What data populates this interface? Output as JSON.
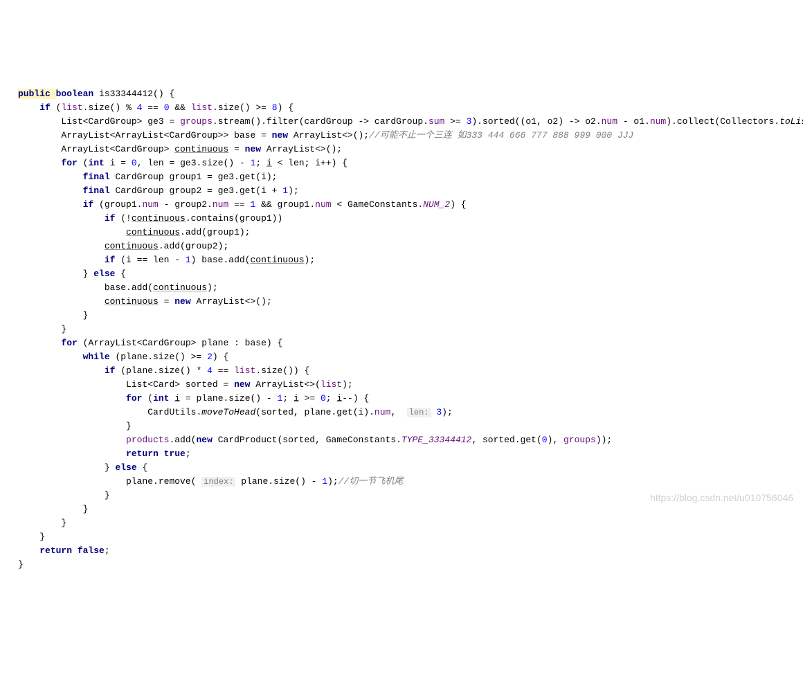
{
  "watermark": "https://blog.csdn.net/u010756046",
  "lines": [
    {
      "indent": 0,
      "tokens": [
        {
          "t": "public ",
          "c": "kw hl"
        },
        {
          "t": "boolean ",
          "c": "kw"
        },
        {
          "t": "is33344412() {",
          "c": ""
        }
      ]
    },
    {
      "indent": 1,
      "tokens": [
        {
          "t": "if ",
          "c": "kw"
        },
        {
          "t": "(",
          "c": ""
        },
        {
          "t": "list",
          "c": "fld"
        },
        {
          "t": ".size() % ",
          "c": ""
        },
        {
          "t": "4",
          "c": "num"
        },
        {
          "t": " == ",
          "c": ""
        },
        {
          "t": "0",
          "c": "num"
        },
        {
          "t": " && ",
          "c": ""
        },
        {
          "t": "list",
          "c": "fld"
        },
        {
          "t": ".size() >= ",
          "c": ""
        },
        {
          "t": "8",
          "c": "num"
        },
        {
          "t": ") {",
          "c": ""
        }
      ]
    },
    {
      "indent": 2,
      "tokens": [
        {
          "t": "List<CardGroup> ge3 = ",
          "c": ""
        },
        {
          "t": "groups",
          "c": "fld"
        },
        {
          "t": ".stream().filter(cardGroup -> cardGroup.",
          "c": ""
        },
        {
          "t": "sum",
          "c": "fld"
        },
        {
          "t": " >= ",
          "c": ""
        },
        {
          "t": "3",
          "c": "num"
        },
        {
          "t": ").sorted((o1, o2) -> o2.",
          "c": ""
        },
        {
          "t": "num",
          "c": "fld"
        },
        {
          "t": " - o1.",
          "c": ""
        },
        {
          "t": "num",
          "c": "fld"
        },
        {
          "t": ").collect(Collectors.",
          "c": ""
        },
        {
          "t": "toList",
          "c": "method-static"
        },
        {
          "t": "());",
          "c": ""
        }
      ]
    },
    {
      "indent": 0,
      "tokens": [
        {
          "t": "",
          "c": ""
        }
      ]
    },
    {
      "indent": 2,
      "tokens": [
        {
          "t": "ArrayList<ArrayList<CardGroup>> base = ",
          "c": ""
        },
        {
          "t": "new ",
          "c": "kw"
        },
        {
          "t": "ArrayList<>();",
          "c": ""
        },
        {
          "t": "//可能不止一个三连 如333 444 666 777 888 999 000 JJJ",
          "c": "cmt"
        }
      ]
    },
    {
      "indent": 2,
      "tokens": [
        {
          "t": "ArrayList<CardGroup> ",
          "c": ""
        },
        {
          "t": "continuous",
          "c": "underline"
        },
        {
          "t": " = ",
          "c": ""
        },
        {
          "t": "new ",
          "c": "kw"
        },
        {
          "t": "ArrayList<>();",
          "c": ""
        }
      ]
    },
    {
      "indent": 2,
      "tokens": [
        {
          "t": "for ",
          "c": "kw"
        },
        {
          "t": "(",
          "c": ""
        },
        {
          "t": "int ",
          "c": "kw"
        },
        {
          "t": "i = ",
          "c": ""
        },
        {
          "t": "0",
          "c": "num"
        },
        {
          "t": ", len = ge3.size() - ",
          "c": ""
        },
        {
          "t": "1",
          "c": "num"
        },
        {
          "t": "; ",
          "c": ""
        },
        {
          "t": "i",
          "c": "underline"
        },
        {
          "t": " < len; i++) {",
          "c": ""
        }
      ]
    },
    {
      "indent": 3,
      "tokens": [
        {
          "t": "final ",
          "c": "kw"
        },
        {
          "t": "CardGroup group1 = ge3.get(i);",
          "c": ""
        }
      ]
    },
    {
      "indent": 3,
      "tokens": [
        {
          "t": "final ",
          "c": "kw"
        },
        {
          "t": "CardGroup group2 = ge3.get(i + ",
          "c": ""
        },
        {
          "t": "1",
          "c": "num"
        },
        {
          "t": ");",
          "c": ""
        }
      ]
    },
    {
      "indent": 3,
      "tokens": [
        {
          "t": "if ",
          "c": "kw"
        },
        {
          "t": "(group1.",
          "c": ""
        },
        {
          "t": "num",
          "c": "fld"
        },
        {
          "t": " - group2.",
          "c": ""
        },
        {
          "t": "num",
          "c": "fld"
        },
        {
          "t": " == ",
          "c": ""
        },
        {
          "t": "1",
          "c": "num"
        },
        {
          "t": " && group1.",
          "c": ""
        },
        {
          "t": "num",
          "c": "fld"
        },
        {
          "t": " < GameConstants.",
          "c": ""
        },
        {
          "t": "NUM_2",
          "c": "fld-static"
        },
        {
          "t": ") {",
          "c": ""
        }
      ]
    },
    {
      "indent": 4,
      "tokens": [
        {
          "t": "if ",
          "c": "kw"
        },
        {
          "t": "(!",
          "c": ""
        },
        {
          "t": "continuous",
          "c": "underline"
        },
        {
          "t": ".contains(group1))",
          "c": ""
        }
      ]
    },
    {
      "indent": 5,
      "tokens": [
        {
          "t": "continuous",
          "c": "underline"
        },
        {
          "t": ".add(group1);",
          "c": ""
        }
      ]
    },
    {
      "indent": 4,
      "tokens": [
        {
          "t": "continuous",
          "c": "underline"
        },
        {
          "t": ".add(group2);",
          "c": ""
        }
      ]
    },
    {
      "indent": 4,
      "tokens": [
        {
          "t": "if ",
          "c": "kw"
        },
        {
          "t": "(i == len - ",
          "c": ""
        },
        {
          "t": "1",
          "c": "num"
        },
        {
          "t": ") base.add(",
          "c": ""
        },
        {
          "t": "continuous",
          "c": "underline"
        },
        {
          "t": ");",
          "c": ""
        }
      ]
    },
    {
      "indent": 3,
      "tokens": [
        {
          "t": "} ",
          "c": ""
        },
        {
          "t": "else ",
          "c": "kw"
        },
        {
          "t": "{",
          "c": ""
        }
      ]
    },
    {
      "indent": 4,
      "tokens": [
        {
          "t": "base.add(",
          "c": ""
        },
        {
          "t": "continuous",
          "c": "underline"
        },
        {
          "t": ");",
          "c": ""
        }
      ]
    },
    {
      "indent": 4,
      "tokens": [
        {
          "t": "continuous",
          "c": "underline"
        },
        {
          "t": " = ",
          "c": ""
        },
        {
          "t": "new ",
          "c": "kw"
        },
        {
          "t": "ArrayList<>();",
          "c": ""
        }
      ]
    },
    {
      "indent": 3,
      "tokens": [
        {
          "t": "}",
          "c": ""
        }
      ]
    },
    {
      "indent": 2,
      "tokens": [
        {
          "t": "}",
          "c": ""
        }
      ]
    },
    {
      "indent": 2,
      "tokens": [
        {
          "t": "for ",
          "c": "kw"
        },
        {
          "t": "(ArrayList<CardGroup> plane : base) {",
          "c": ""
        }
      ]
    },
    {
      "indent": 3,
      "tokens": [
        {
          "t": "while ",
          "c": "kw"
        },
        {
          "t": "(plane.size() >= ",
          "c": ""
        },
        {
          "t": "2",
          "c": "num"
        },
        {
          "t": ") {",
          "c": ""
        }
      ]
    },
    {
      "indent": 4,
      "tokens": [
        {
          "t": "if ",
          "c": "kw"
        },
        {
          "t": "(plane.size() * ",
          "c": ""
        },
        {
          "t": "4",
          "c": "num"
        },
        {
          "t": " == ",
          "c": ""
        },
        {
          "t": "list",
          "c": "fld"
        },
        {
          "t": ".size()) {",
          "c": ""
        }
      ]
    },
    {
      "indent": 5,
      "tokens": [
        {
          "t": "List<Card> sorted = ",
          "c": ""
        },
        {
          "t": "new ",
          "c": "kw"
        },
        {
          "t": "ArrayList<>(",
          "c": ""
        },
        {
          "t": "list",
          "c": "fld"
        },
        {
          "t": ");",
          "c": ""
        }
      ]
    },
    {
      "indent": 5,
      "tokens": [
        {
          "t": "for ",
          "c": "kw"
        },
        {
          "t": "(",
          "c": ""
        },
        {
          "t": "int ",
          "c": "kw"
        },
        {
          "t": "i",
          "c": "underline"
        },
        {
          "t": " = plane.size() - ",
          "c": ""
        },
        {
          "t": "1",
          "c": "num"
        },
        {
          "t": "; ",
          "c": ""
        },
        {
          "t": "i",
          "c": "underline"
        },
        {
          "t": " >= ",
          "c": ""
        },
        {
          "t": "0",
          "c": "num"
        },
        {
          "t": "; ",
          "c": ""
        },
        {
          "t": "i",
          "c": "underline"
        },
        {
          "t": "--) {",
          "c": ""
        }
      ]
    },
    {
      "indent": 6,
      "tokens": [
        {
          "t": "CardUtils.",
          "c": ""
        },
        {
          "t": "moveToHead",
          "c": "method-static"
        },
        {
          "t": "(sorted, plane.get(i).",
          "c": ""
        },
        {
          "t": "num",
          "c": "fld"
        },
        {
          "t": ",  ",
          "c": ""
        },
        {
          "t": "len:",
          "c": "param-hint"
        },
        {
          "t": " ",
          "c": ""
        },
        {
          "t": "3",
          "c": "num"
        },
        {
          "t": ");",
          "c": ""
        }
      ]
    },
    {
      "indent": 5,
      "tokens": [
        {
          "t": "}",
          "c": ""
        }
      ]
    },
    {
      "indent": 5,
      "tokens": [
        {
          "t": "products",
          "c": "fld"
        },
        {
          "t": ".add(",
          "c": ""
        },
        {
          "t": "new ",
          "c": "kw"
        },
        {
          "t": "CardProduct(sorted, GameConstants.",
          "c": ""
        },
        {
          "t": "TYPE_33344412",
          "c": "fld-static"
        },
        {
          "t": ", sorted.get(",
          "c": ""
        },
        {
          "t": "0",
          "c": "num"
        },
        {
          "t": "), ",
          "c": ""
        },
        {
          "t": "groups",
          "c": "fld"
        },
        {
          "t": "));",
          "c": ""
        }
      ]
    },
    {
      "indent": 5,
      "tokens": [
        {
          "t": "return true",
          "c": "kw"
        },
        {
          "t": ";",
          "c": ""
        }
      ]
    },
    {
      "indent": 4,
      "tokens": [
        {
          "t": "} ",
          "c": ""
        },
        {
          "t": "else ",
          "c": "kw"
        },
        {
          "t": "{",
          "c": ""
        }
      ]
    },
    {
      "indent": 5,
      "tokens": [
        {
          "t": "plane.remove( ",
          "c": ""
        },
        {
          "t": "index:",
          "c": "param-hint"
        },
        {
          "t": " plane.size() - ",
          "c": ""
        },
        {
          "t": "1",
          "c": "num"
        },
        {
          "t": ");",
          "c": ""
        },
        {
          "t": "//切一节飞机尾",
          "c": "cmt"
        }
      ]
    },
    {
      "indent": 4,
      "tokens": [
        {
          "t": "}",
          "c": ""
        }
      ]
    },
    {
      "indent": 3,
      "tokens": [
        {
          "t": "}",
          "c": ""
        }
      ]
    },
    {
      "indent": 2,
      "tokens": [
        {
          "t": "}",
          "c": ""
        }
      ]
    },
    {
      "indent": 1,
      "tokens": [
        {
          "t": "}",
          "c": ""
        }
      ]
    },
    {
      "indent": 1,
      "tokens": [
        {
          "t": "return false",
          "c": "kw"
        },
        {
          "t": ";",
          "c": ""
        }
      ]
    },
    {
      "indent": 0,
      "tokens": [
        {
          "t": "}",
          "c": ""
        }
      ]
    }
  ]
}
